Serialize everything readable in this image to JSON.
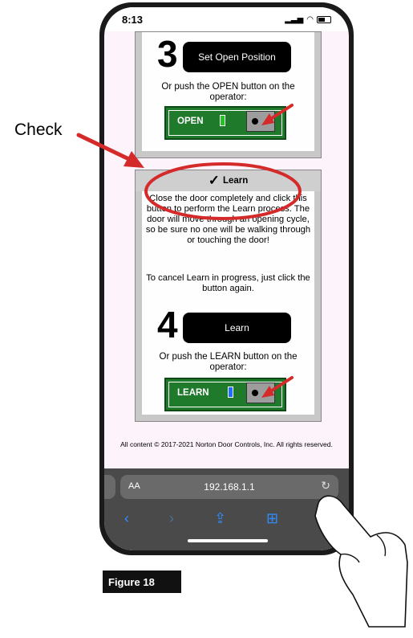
{
  "status": {
    "time": "8:13"
  },
  "step3": {
    "number": "3",
    "button_label": "Set Open Position",
    "note": "Or push the OPEN button on the operator:",
    "operator_label": "OPEN",
    "led_color": "#22c322"
  },
  "learn": {
    "header_label": "Learn",
    "description": "Close the door completely and click this button to perform the Learn process. The door will move through an opening cycle, so be sure no one will be walking through or touching the door!",
    "cancel_note": "To cancel Learn in progress, just click the button again.",
    "number": "4",
    "button_label": "Learn",
    "note": "Or push the LEARN button on the operator:",
    "operator_label": "LEARN",
    "led_color": "#1e6fff"
  },
  "footer": {
    "copyright": "All content © 2017-2021 Norton Door Controls, Inc. All rights reserved."
  },
  "browser": {
    "aa_label": "AA",
    "url": "192.168.1.1"
  },
  "annotations": {
    "check_label": "Check",
    "figure_label": "Figure 18",
    "arrow_color": "#d42a2a"
  }
}
